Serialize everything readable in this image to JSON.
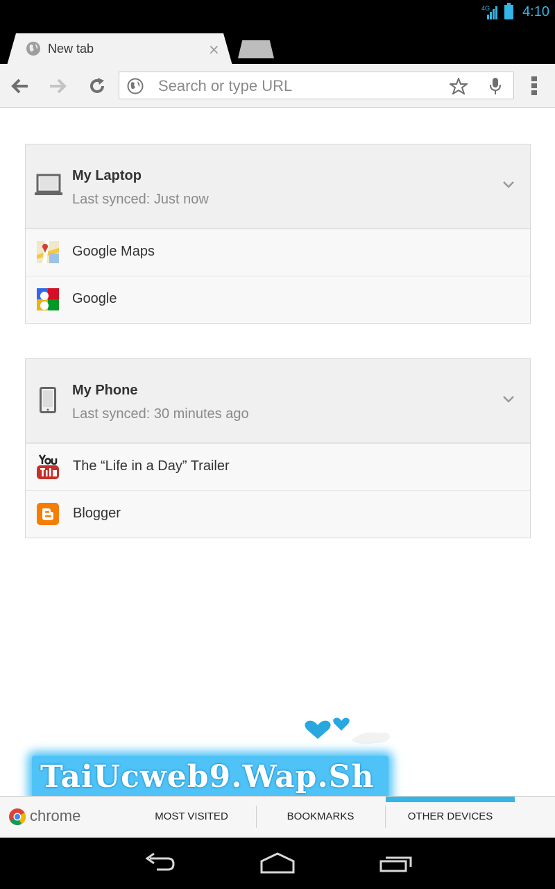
{
  "status_bar": {
    "time": "4:10",
    "network": "4G",
    "accent": "#33b5e5"
  },
  "tab": {
    "title": "New tab",
    "close_symbol": "×"
  },
  "omnibox": {
    "placeholder": "Search or type URL"
  },
  "icons": {
    "back": "back-arrow-icon",
    "forward": "forward-arrow-icon",
    "reload": "reload-icon",
    "star": "star-icon",
    "mic": "microphone-icon",
    "menu": "overflow-menu-icon"
  },
  "devices": [
    {
      "name": "My Laptop",
      "last_synced": "Last synced: Just now",
      "icon": "laptop-icon",
      "tabs": [
        {
          "label": "Google  Maps",
          "icon": "google-maps-icon"
        },
        {
          "label": "Google",
          "icon": "google-icon"
        }
      ]
    },
    {
      "name": "My Phone",
      "last_synced": "Last synced: 30 minutes ago",
      "icon": "phone-icon",
      "tabs": [
        {
          "label": "The “Life in a Day” Trailer",
          "icon": "youtube-icon"
        },
        {
          "label": "Blogger",
          "icon": "blogger-icon"
        }
      ]
    }
  ],
  "watermark": {
    "text": "TaiUcweb9.Wap.Sh"
  },
  "bottom_nav": {
    "brand": "chrome",
    "tabs": [
      "MOST VISITED",
      "BOOKMARKS",
      "OTHER DEVICES"
    ],
    "selected": "OTHER DEVICES"
  }
}
